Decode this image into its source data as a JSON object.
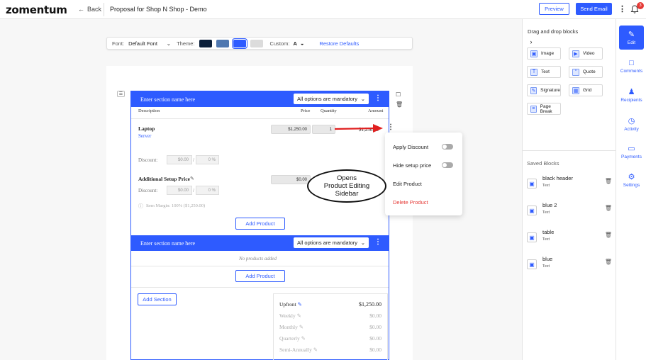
{
  "header": {
    "logo": "zomentum",
    "back_label": "Back",
    "doc_title": "Proposal for Shop N Shop - Demo",
    "preview_label": "Preview",
    "send_label": "Send Email",
    "notif_count": "3"
  },
  "toolbar": {
    "font_label": "Font:",
    "font_value": "Default Font",
    "theme_label": "Theme:",
    "theme_colors": [
      "#0b1f3a",
      "#5078b0",
      "#2e5bff",
      "#dcdcdc"
    ],
    "custom_label": "Custom:",
    "restore_label": "Restore Defaults"
  },
  "section1": {
    "name_placeholder": "Enter section name here",
    "option": "All options are mandatory",
    "columns": {
      "description": "Description",
      "price": "Price",
      "quantity": "Quantity",
      "amount": "Amount"
    },
    "product": {
      "name": "Laptop",
      "subtitle": "Server",
      "price": "$1,250.00",
      "quantity": "1",
      "amount": "$1,250.00",
      "discount_label": "Discount:",
      "discount_amount": "$0.00",
      "discount_sep": "/",
      "discount_pct": "0 %"
    },
    "setup": {
      "name": "Additional Setup Price",
      "price": "$0.00",
      "discount_label": "Discount:",
      "discount_amount": "$0.00",
      "discount_sep": "/",
      "discount_pct": "0 %",
      "margin": "Item Margin: 100% ($1,250.00)"
    },
    "add_product": "Add Product"
  },
  "section2": {
    "name_placeholder": "Enter section name here",
    "option": "All options are mandatory",
    "empty": "No products added",
    "add_product": "Add Product"
  },
  "add_section": "Add Section",
  "summary": [
    {
      "label": "Upfront",
      "value": "$1,250.00"
    },
    {
      "label": "Weekly",
      "value": "$0.00"
    },
    {
      "label": "Monthly",
      "value": "$0.00"
    },
    {
      "label": "Quarterly",
      "value": "$0.00"
    },
    {
      "label": "Semi-Annually",
      "value": "$0.00"
    }
  ],
  "popup": {
    "apply_discount": "Apply Discount",
    "hide_setup": "Hide setup price",
    "edit_product": "Edit Product",
    "delete_product": "Delete Product"
  },
  "callout": {
    "line1": "Opens",
    "line2": "Product Editing",
    "line3": "Sidebar"
  },
  "sidebar": {
    "title": "Drag and drop blocks",
    "blocks": [
      {
        "label": "Image",
        "icon": "image-icon"
      },
      {
        "label": "Video",
        "icon": "video-icon"
      },
      {
        "label": "Text",
        "icon": "text-icon"
      },
      {
        "label": "Quote",
        "icon": "quote-icon"
      },
      {
        "label": "Signature",
        "icon": "signature-icon"
      },
      {
        "label": "Grid",
        "icon": "grid-icon"
      },
      {
        "label": "Page Break",
        "icon": "page-break-icon"
      }
    ],
    "saved_title": "Saved Blocks",
    "saved": [
      {
        "name": "black header",
        "type": "Text"
      },
      {
        "name": "blue 2",
        "type": "Text"
      },
      {
        "name": "table",
        "type": "Text"
      },
      {
        "name": "blue",
        "type": "Text"
      }
    ]
  },
  "rail": {
    "items": [
      {
        "label": "Edit",
        "icon": "pencil-icon"
      },
      {
        "label": "Comments",
        "icon": "comment-icon"
      },
      {
        "label": "Recipients",
        "icon": "users-icon"
      },
      {
        "label": "Activity",
        "icon": "clock-icon"
      },
      {
        "label": "Payments",
        "icon": "card-icon"
      },
      {
        "label": "Settings",
        "icon": "gear-icon"
      }
    ]
  },
  "colors": {
    "accent": "#2e5bff",
    "danger": "#e53935"
  }
}
